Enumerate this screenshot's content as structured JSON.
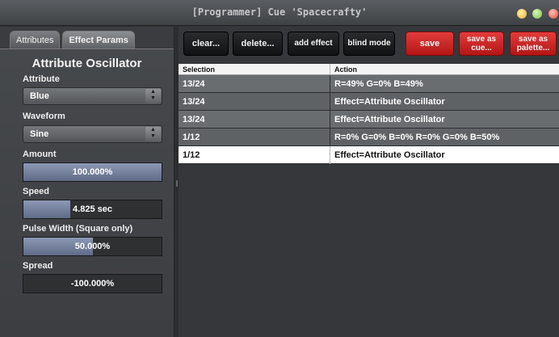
{
  "window": {
    "title": "[Programmer] Cue 'Spacecrafty'"
  },
  "tabs": [
    {
      "label": "Attributes",
      "active": false
    },
    {
      "label": "Effect Params",
      "active": true
    }
  ],
  "panel": {
    "title": "Attribute Oscillator",
    "attribute": {
      "label": "Attribute",
      "value": "Blue"
    },
    "waveform": {
      "label": "Waveform",
      "value": "Sine"
    },
    "amount": {
      "label": "Amount",
      "value": "100.000%",
      "fraction": 1.0
    },
    "speed": {
      "label": "Speed",
      "value": "4.825 sec",
      "fraction": 0.34
    },
    "pulse_width": {
      "label": "Pulse Width (Square only)",
      "value": "50.000%",
      "fraction": 0.5
    },
    "spread": {
      "label": "Spread",
      "value": "-100.000%",
      "fraction": 0.0
    }
  },
  "toolbar": {
    "clear": "clear...",
    "delete": "delete...",
    "add_effect": "add effect",
    "blind_mode": "blind mode",
    "save": "save",
    "save_as_cue_1": "save as",
    "save_as_cue_2": "cue...",
    "save_as_palette_1": "save as",
    "save_as_palette_2": "palette..."
  },
  "table": {
    "headers": {
      "selection": "Selection",
      "action": "Action"
    },
    "rows": [
      {
        "selection": "13/24",
        "action": "R=49% G=0% B=49%"
      },
      {
        "selection": "13/24",
        "action": "Effect=Attribute Oscillator"
      },
      {
        "selection": "13/24",
        "action": "Effect=Attribute Oscillator"
      },
      {
        "selection": "1/12",
        "action": "R=0% G=0% B=0% R=0% G=0% B=50%"
      },
      {
        "selection": "1/12",
        "action": "Effect=Attribute Oscillator"
      }
    ]
  },
  "colors": {
    "accent_red": "#d22a2a",
    "slider_fill": "#7682a0",
    "selected_row": "#ffffff"
  },
  "icons": {
    "select_arrows": "up-down-arrows-icon"
  }
}
